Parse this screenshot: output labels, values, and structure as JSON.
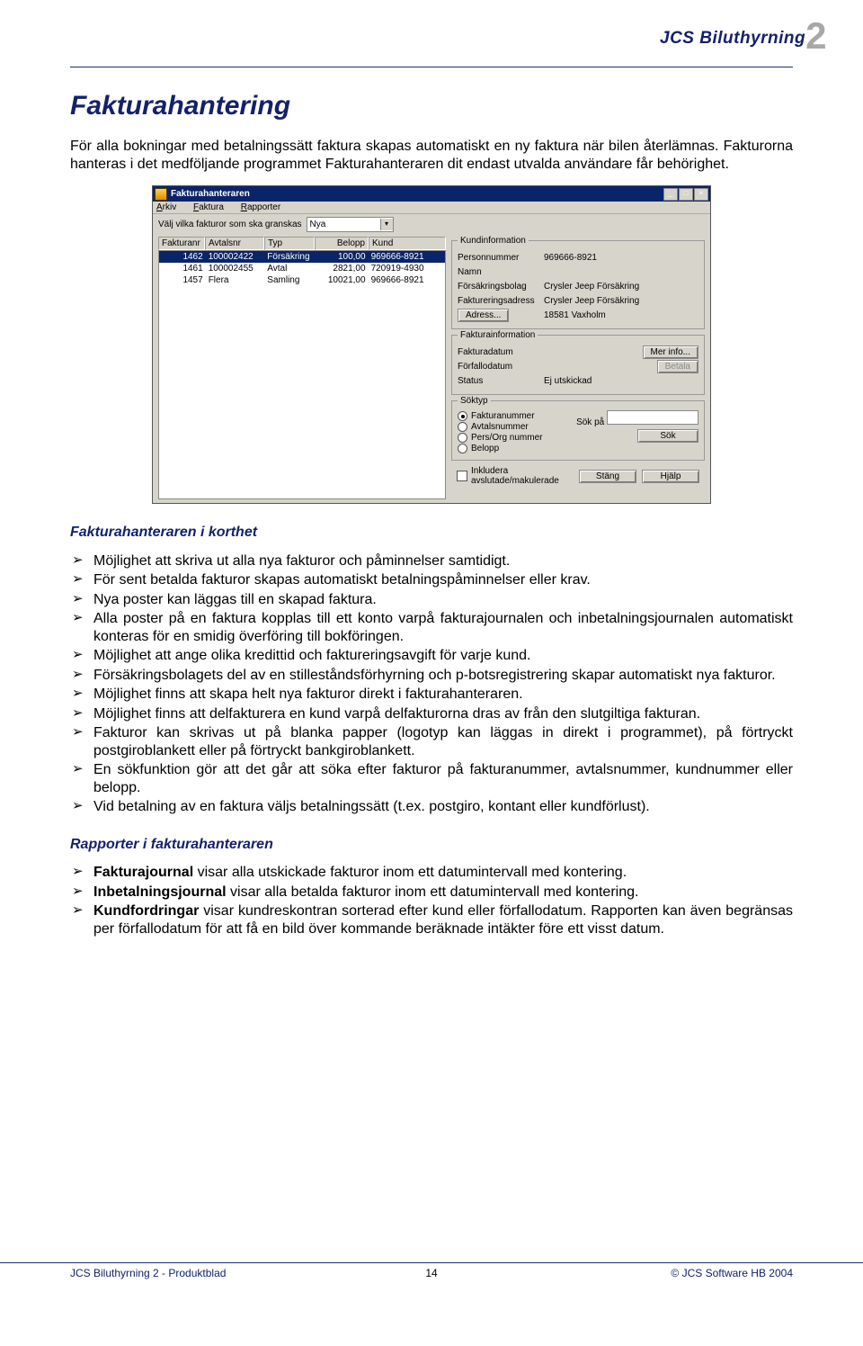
{
  "logo": {
    "text": "JCS Biluthyrning",
    "digit": "2"
  },
  "heading": "Fakturahantering",
  "intro": "För alla bokningar med betalningssätt faktura skapas automatiskt en ny faktura när bilen återlämnas. Fakturorna hanteras i det medföljande programmet Fakturahanteraren dit endast utvalda användare får behörighet.",
  "app": {
    "title": "Fakturahanteraren",
    "menu": {
      "arkiv": "Arkiv",
      "faktura": "Faktura",
      "rapporter": "Rapporter"
    },
    "filter_label": "Välj vilka fakturor som ska granskas",
    "filter_value": "Nya",
    "columns": {
      "fakturanr": "Fakturanr",
      "avtalsnr": "Avtalsnr",
      "typ": "Typ",
      "belopp": "Belopp",
      "kund": "Kund"
    },
    "rows": [
      {
        "fakturanr": "1462",
        "avtalsnr": "100002422",
        "typ": "Försäkring",
        "belopp": "100,00",
        "kund": "969666-8921"
      },
      {
        "fakturanr": "1461",
        "avtalsnr": "100002455",
        "typ": "Avtal",
        "belopp": "2821,00",
        "kund": "720919-4930"
      },
      {
        "fakturanr": "1457",
        "avtalsnr": "Flera",
        "typ": "Samling",
        "belopp": "10021,00",
        "kund": "969666-8921"
      }
    ],
    "kund": {
      "title": "Kundinformation",
      "personnummer_l": "Personnummer",
      "personnummer_v": "969666-8921",
      "namn_l": "Namn",
      "namn_v": "",
      "bolag_l": "Försäkringsbolag",
      "bolag_v": "Crysler Jeep Försäkring",
      "adress_l": "Faktureringsadress",
      "adress_v": "Crysler Jeep Försäkring",
      "post_v": "18581 Vaxholm",
      "adress_btn": "Adress..."
    },
    "fakt": {
      "title": "Fakturainformation",
      "datum_l": "Fakturadatum",
      "datum_v": "",
      "forfall_l": "Förfallodatum",
      "forfall_v": "",
      "status_l": "Status",
      "status_v": "Ej utskickad",
      "merinfo_btn": "Mer info...",
      "betala_btn": "Betala"
    },
    "sok": {
      "title": "Söktyp",
      "fakturanummer": "Fakturanummer",
      "avtalsnummer": "Avtalsnummer",
      "persorg": "Pers/Org nummer",
      "belopp": "Belopp",
      "inkludera": "Inkludera avslutade/makulerade",
      "sokpa_l": "Sök på",
      "sok_btn": "Sök",
      "stang_btn": "Stäng",
      "hjalp_btn": "Hjälp"
    }
  },
  "sub1": "Fakturahanteraren i korthet",
  "list1": [
    "Möjlighet att skriva ut alla nya fakturor och påminnelser samtidigt.",
    "För sent betalda fakturor skapas automatiskt betalningspåminnelser eller krav.",
    "Nya poster kan läggas till en skapad faktura.",
    "Alla poster på en faktura kopplas till ett konto varpå fakturajournalen och inbetalningsjournalen automatiskt konteras för en smidig överföring till bokföringen.",
    "Möjlighet att ange olika kredittid och faktureringsavgift för varje kund.",
    "Försäkringsbolagets del av en stilleståndsförhyrning och p-botsregistrering skapar automatiskt nya fakturor.",
    "Möjlighet finns att skapa helt nya fakturor direkt i fakturahanteraren.",
    "Möjlighet finns att delfakturera en kund varpå delfakturorna dras av från den slutgiltiga fakturan.",
    "Fakturor kan skrivas ut på blanka papper (logotyp kan läggas in direkt i programmet), på förtryckt postgiroblankett eller på förtryckt bankgiroblankett.",
    "En sökfunktion gör att det går att söka efter fakturor på fakturanummer, avtalsnummer, kundnummer eller belopp.",
    "Vid betalning av en faktura väljs betalningssätt (t.ex. postgiro, kontant eller kundförlust)."
  ],
  "sub2": "Rapporter i fakturahanteraren",
  "list2": [
    {
      "b": "Fakturajournal",
      "t": " visar alla utskickade fakturor inom ett datumintervall med kontering."
    },
    {
      "b": "Inbetalningsjournal",
      "t": " visar alla betalda fakturor inom ett datumintervall med kontering."
    },
    {
      "b": "Kundfordringar",
      "t": " visar kundreskontran sorterad efter kund eller förfallodatum. Rapporten kan även begränsas per förfallodatum för att få en bild över kommande beräknade intäkter före ett visst datum."
    }
  ],
  "footer": {
    "left": "JCS Biluthyrning 2 - Produktblad",
    "center": "14",
    "right": "© JCS Software HB 2004"
  }
}
